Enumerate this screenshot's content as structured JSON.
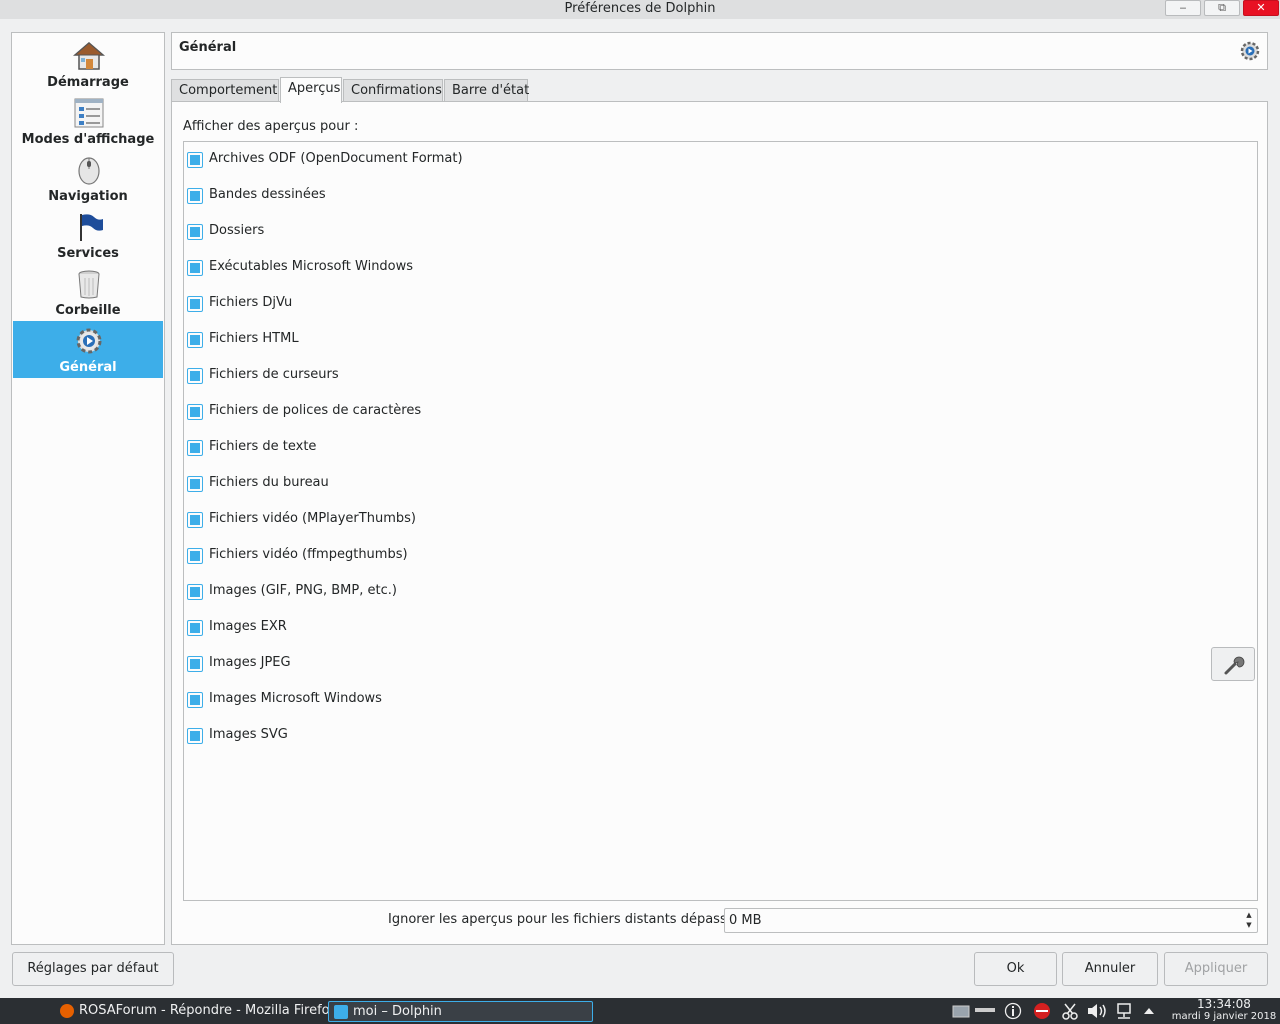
{
  "window": {
    "title": "Préférences de Dolphin",
    "min_glyph": "‒",
    "max_glyph": "⧉",
    "close_glyph": "✕"
  },
  "sidebar": {
    "items": [
      {
        "label": "Démarrage",
        "icon": "home-icon"
      },
      {
        "label": "Modes d'affichage",
        "icon": "view-modes-icon"
      },
      {
        "label": "Navigation",
        "icon": "mouse-icon"
      },
      {
        "label": "Services",
        "icon": "flag-icon"
      },
      {
        "label": "Corbeille",
        "icon": "trash-icon"
      },
      {
        "label": "Général",
        "icon": "settings-gear-icon",
        "active": true
      }
    ]
  },
  "header": {
    "title": "Général",
    "icon": "settings-gear-icon"
  },
  "tabs": [
    {
      "label": "Comportement"
    },
    {
      "label": "Aperçus",
      "active": true
    },
    {
      "label": "Confirmations"
    },
    {
      "label": "Barre d'état"
    }
  ],
  "previews": {
    "heading": "Afficher des aperçus pour :",
    "items": [
      {
        "label": "Archives ODF (OpenDocument Format)",
        "checked": true
      },
      {
        "label": "Bandes dessinées",
        "checked": true
      },
      {
        "label": "Dossiers",
        "checked": true
      },
      {
        "label": "Exécutables Microsoft Windows",
        "checked": true
      },
      {
        "label": "Fichiers DjVu",
        "checked": true
      },
      {
        "label": "Fichiers HTML",
        "checked": true
      },
      {
        "label": "Fichiers de curseurs",
        "checked": true
      },
      {
        "label": "Fichiers de polices de caractères",
        "checked": true
      },
      {
        "label": "Fichiers de texte",
        "checked": true
      },
      {
        "label": "Fichiers du bureau",
        "checked": true
      },
      {
        "label": "Fichiers vidéo (MPlayerThumbs)",
        "checked": true
      },
      {
        "label": "Fichiers vidéo (ffmpegthumbs)",
        "checked": true
      },
      {
        "label": "Images (GIF, PNG, BMP, etc.)",
        "checked": true
      },
      {
        "label": "Images EXR",
        "checked": true
      },
      {
        "label": "Images JPEG",
        "checked": true
      },
      {
        "label": "Images Microsoft Windows",
        "checked": true
      },
      {
        "label": "Images SVG",
        "checked": true
      }
    ],
    "configure_icon": "wrench-icon"
  },
  "remote": {
    "label": "Ignorer les aperçus pour les fichiers distants dépassant :",
    "value": "0 MB"
  },
  "buttons": {
    "defaults": "Réglages par défaut",
    "ok": "Ok",
    "cancel": "Annuler",
    "apply": "Appliquer"
  },
  "taskbar": {
    "tasks": [
      {
        "label": "ROSAForum - Répondre - Mozilla Firefox",
        "icon": "firefox-icon"
      },
      {
        "label": "moi – Dolphin",
        "icon": "dolphin-icon",
        "active": true
      }
    ],
    "clock_time": "13:34:08",
    "clock_date": "mardi 9 janvier 2018"
  },
  "colors": {
    "accent": "#3daee9",
    "background": "#eff0f1",
    "panel": "#fcfcfc",
    "taskbar": "#2b2f33"
  }
}
